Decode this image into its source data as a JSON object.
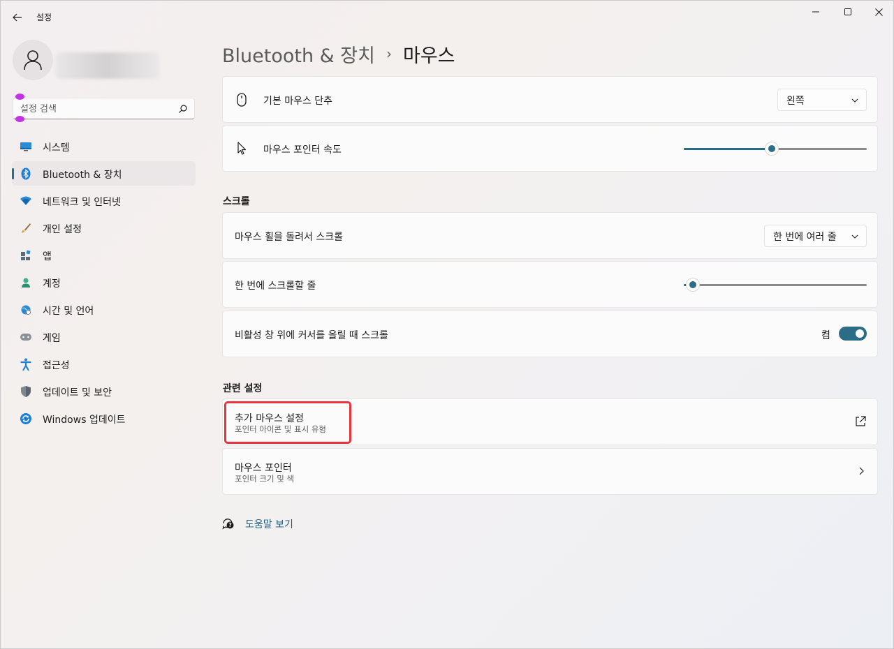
{
  "window": {
    "app_title": "설정"
  },
  "sidebar": {
    "search_placeholder": "설정 검색",
    "items": [
      {
        "label": "시스템",
        "icon": "system-icon"
      },
      {
        "label": "Bluetooth & 장치",
        "icon": "bluetooth-icon",
        "active": true
      },
      {
        "label": "네트워크 및 인터넷",
        "icon": "wifi-icon"
      },
      {
        "label": "개인 설정",
        "icon": "brush-icon"
      },
      {
        "label": "앱",
        "icon": "apps-icon"
      },
      {
        "label": "계정",
        "icon": "account-icon"
      },
      {
        "label": "시간 및 언어",
        "icon": "time-language-icon"
      },
      {
        "label": "게임",
        "icon": "gaming-icon"
      },
      {
        "label": "접근성",
        "icon": "accessibility-icon"
      },
      {
        "label": "업데이트 및 보안",
        "icon": "shield-icon"
      },
      {
        "label": "Windows 업데이트",
        "icon": "windows-update-icon"
      }
    ]
  },
  "main": {
    "breadcrumb_parent": "Bluetooth & 장치",
    "breadcrumb_sep": "›",
    "breadcrumb_current": "마우스",
    "primary_button": {
      "label": "기본 마우스 단추",
      "value": "왼쪽"
    },
    "pointer_speed": {
      "label": "마우스 포인터 속도",
      "level": 0.48
    },
    "scroll_section": "스크롤",
    "wheel_scroll": {
      "label": "마우스 휠을 돌려서 스크롤",
      "value": "한 번에 여러 줄"
    },
    "lines_per_scroll": {
      "label": "한 번에 스크롤할 줄",
      "level": 0.05
    },
    "inactive_scroll": {
      "label": "비활성 창 위에 커서를 올릴 때 스크롤",
      "state": "켬",
      "on": true
    },
    "related_section": "관련 설정",
    "additional_mouse": {
      "title": "추가 마우스 설정",
      "subtitle": "포인터 아이콘 및 표시 유형"
    },
    "mouse_pointer": {
      "title": "마우스 포인터",
      "subtitle": "포인터 크기 및 색"
    },
    "help_label": "도움말 보기"
  },
  "colors": {
    "accent": "#2b6d86",
    "highlight": "#e8353c"
  }
}
